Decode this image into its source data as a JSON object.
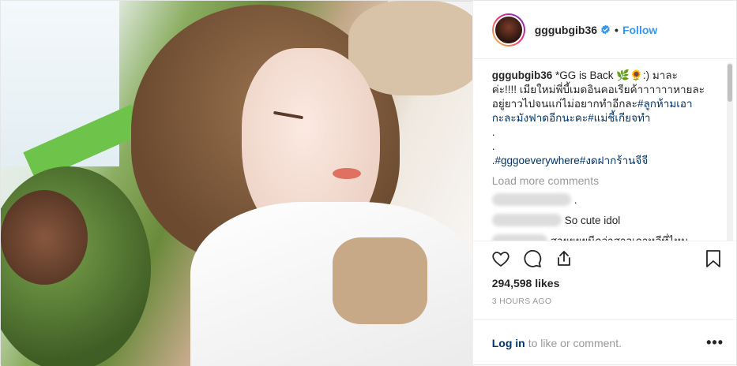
{
  "post": {
    "username": "gggubgib36",
    "follow_label": "Follow",
    "separator": "•",
    "caption": {
      "username": "gggubgib36",
      "line1": "*GG is Back 🌿🌻:) มาละ",
      "line2": "ค่ะ!!!! เมียใหม่พี่บี้เมดอินคอเรียค้าาาาาาหายละ",
      "line3": "อยู่ยาวไปจนแก่ไม่อยากทำอีกละ",
      "tag1": "#ลูกห้ามเอา",
      "tag1b": "กะละมังฟาดอีกนะคะ",
      "tag2": "#แม่ชี้เกียจทำ",
      "dot1": ".",
      "dot2": ".",
      "dot3": ".",
      "tag3": "#gggoeverywhere",
      "tag4": "#งดฝากร้านจีจี"
    },
    "load_more": "Load more comments",
    "comments": [
      {
        "text": "."
      },
      {
        "text": "So cute idol"
      },
      {
        "text": "สวยยยยนีกว่าสาวเกาหลีที่ไหน"
      }
    ],
    "likes": "294,598 likes",
    "time": "3 HOURS AGO",
    "login_label": "Log in",
    "login_suffix": "to like or comment.",
    "more_label": "•••"
  },
  "icons": [
    "heart-icon",
    "comment-icon",
    "share-icon",
    "bookmark-icon",
    "verified-badge-icon"
  ],
  "colors": {
    "link": "#3897f0",
    "hashtag": "#003569",
    "muted": "#999999",
    "verified": "#3897f0"
  }
}
